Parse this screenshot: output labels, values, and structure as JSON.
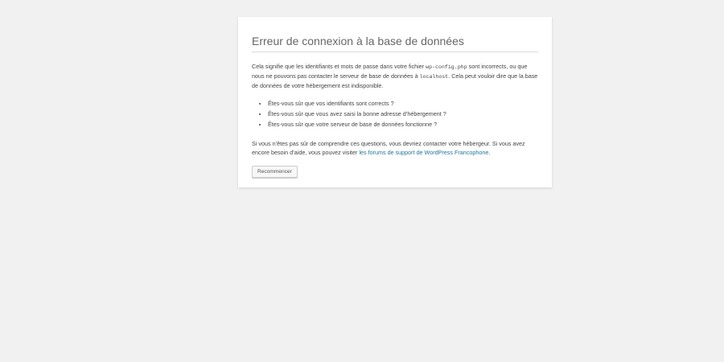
{
  "error": {
    "title": "Erreur de connexion à la base de données",
    "para1": {
      "part1": "Cela signifie que les identifiants et mots de passe dans votre fichier ",
      "code1": "wp-config.php",
      "part2": " sont incorrects, ou que nous ne pouvons pas contacter le serveur de base de données à ",
      "code2": "localhost",
      "part3": ". Cela peut vouloir dire que la base de données de votre hébergement est indisponible."
    },
    "list": [
      "Êtes-vous sûr que vos identifiants sont corrects ?",
      "Êtes-vous sûr que vous avez saisi la bonne adresse d’hébergement ?",
      "Êtes-vous sûr que votre serveur de base de données fonctionne ?"
    ],
    "para2": {
      "part1": "Si vous n’êtes pas sûr de comprendre ces questions, vous devriez contacter votre hébergeur. Si vous avez encore besoin d’aide, vous pouvez visiter ",
      "link": "les forums de support de WordPress Francophone",
      "part2": "."
    },
    "button_label": "Recommencer"
  },
  "colors": {
    "background": "#f1f1f1",
    "panel": "#ffffff",
    "link": "#21759b",
    "text": "#444444"
  }
}
